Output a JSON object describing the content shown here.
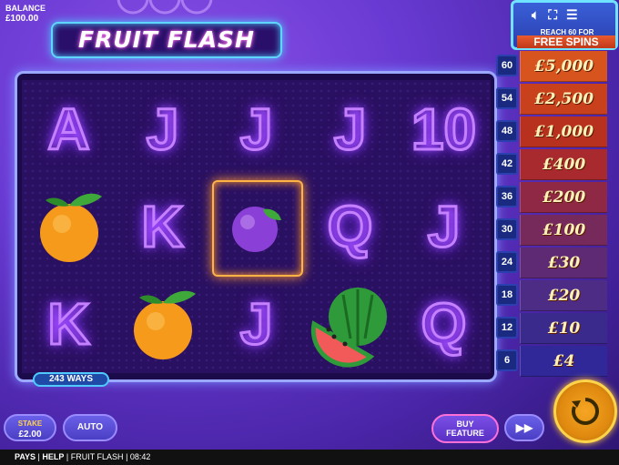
{
  "balance": {
    "label": "BALANCE",
    "value": "£100.00"
  },
  "logo": {
    "title": "FRUIT FLASH"
  },
  "ways": "243 WAYS",
  "ladder": {
    "reach_text": "REACH 60",
    "for_text": "FOR",
    "free_spins": "FREE SPINS",
    "rungs": [
      {
        "count": "60",
        "prize": "£5,000",
        "color": "#d8541e"
      },
      {
        "count": "54",
        "prize": "£2,500",
        "color": "#c8401c"
      },
      {
        "count": "48",
        "prize": "£1,000",
        "color": "#b8301e"
      },
      {
        "count": "42",
        "prize": "£400",
        "color": "#a82a2e"
      },
      {
        "count": "36",
        "prize": "£200",
        "color": "#8e2844"
      },
      {
        "count": "30",
        "prize": "£100",
        "color": "#762a5c"
      },
      {
        "count": "24",
        "prize": "£30",
        "color": "#5e2a74"
      },
      {
        "count": "18",
        "prize": "£20",
        "color": "#4c2c84"
      },
      {
        "count": "12",
        "prize": "£10",
        "color": "#3a2a8c"
      },
      {
        "count": "6",
        "prize": "£4",
        "color": "#302898"
      }
    ]
  },
  "reels": [
    [
      "A",
      "orange",
      "K"
    ],
    [
      "J",
      "K",
      "orange"
    ],
    [
      "J",
      "plum",
      "J"
    ],
    [
      "J",
      "Q",
      "watermelon"
    ],
    [
      "10",
      "J",
      "Q"
    ]
  ],
  "controls": {
    "stake_label": "STAKE",
    "stake_value": "£2.00",
    "auto": "AUTO",
    "buy_line1": "BUY",
    "buy_line2": "FEATURE",
    "fast_forward": "▶▶"
  },
  "footer": {
    "pays": "PAYS",
    "help": "HELP",
    "game": "FRUIT FLASH",
    "time": "08:42"
  },
  "colors": {
    "accent": "#f6a623",
    "frame": "#9aa8ff",
    "neon_letter": "#c580ff"
  }
}
